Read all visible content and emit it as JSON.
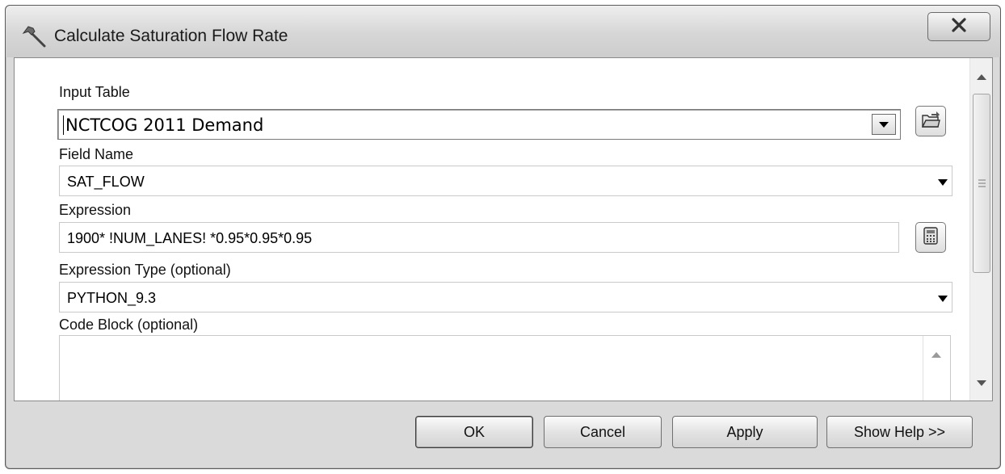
{
  "window": {
    "title": "Calculate Saturation Flow Rate",
    "close_label": "X"
  },
  "form": {
    "input_table": {
      "label": "Input Table",
      "value": "NCTCOG 2011 Demand"
    },
    "field_name": {
      "label": "Field Name",
      "value": "SAT_FLOW"
    },
    "expression": {
      "label": "Expression",
      "value": "1900* !NUM_LANES! *0.95*0.95*0.95"
    },
    "expression_type": {
      "label": "Expression Type (optional)",
      "value": "PYTHON_9.3"
    },
    "code_block": {
      "label": "Code Block (optional)",
      "value": ""
    }
  },
  "buttons": {
    "ok": "OK",
    "cancel": "Cancel",
    "apply": "Apply",
    "show_help": "Show Help >>"
  },
  "icons": {
    "title": "hammer-icon",
    "browse": "open-folder-icon",
    "expression_builder": "calculator-icon"
  }
}
